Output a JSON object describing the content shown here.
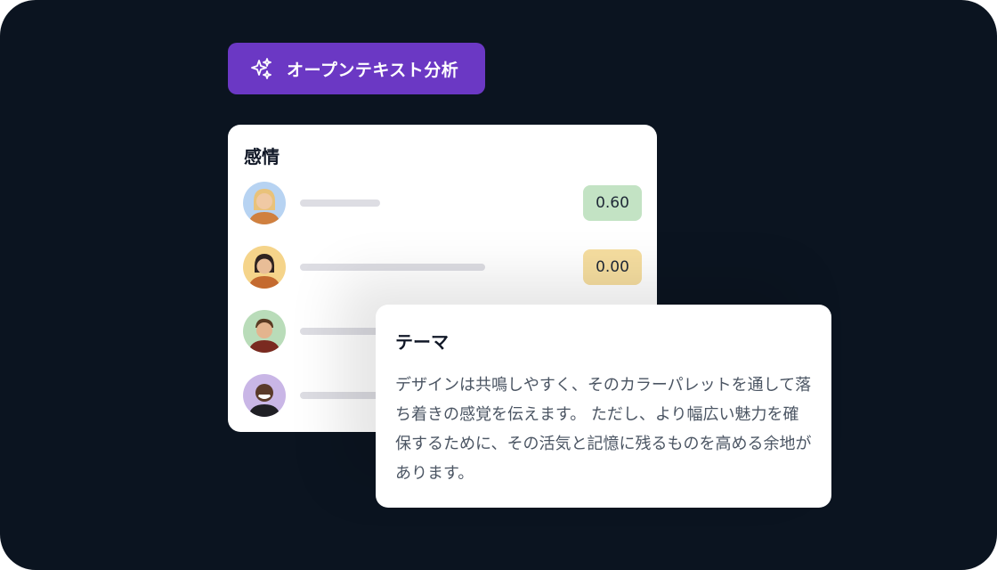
{
  "badge": {
    "icon": "sparkles-icon",
    "label": "オープンテキスト分析",
    "color": "#6b38c4"
  },
  "sentiment_card": {
    "title": "感情",
    "rows": [
      {
        "avatar_bg": "#b7d3f2",
        "score": "0.60",
        "score_color": "#c3e3c4"
      },
      {
        "avatar_bg": "#f5d48a",
        "score": "0.00",
        "score_color": "#f6dea0"
      },
      {
        "avatar_bg": "#b9dcb9",
        "score": "",
        "score_color": ""
      },
      {
        "avatar_bg": "#c9b6e6",
        "score": "",
        "score_color": ""
      }
    ]
  },
  "theme_card": {
    "title": "テーマ",
    "body": "デザインは共鳴しやすく、そのカラーパレットを通して落ち着きの感覚を伝えます。 ただし、より幅広い魅力を確保するために、その活気と記憶に残るものを高める余地があります。"
  }
}
